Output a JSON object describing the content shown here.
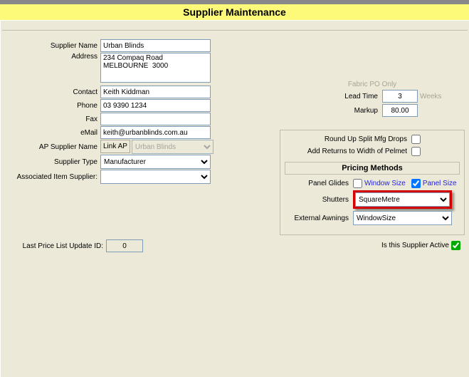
{
  "title": "Supplier Maintenance",
  "labels": {
    "supplier_name": "Supplier Name",
    "address": "Address",
    "contact": "Contact",
    "phone": "Phone",
    "fax": "Fax",
    "email": "eMail",
    "ap_supplier_name": "AP Supplier Name",
    "link_ap": "Link AP",
    "supplier_type": "Supplier Type",
    "associated_item_supplier": "Associated Item Supplier:",
    "last_price_id": "Last Price List Update ID:",
    "fabric_po_only": "Fabric PO Only",
    "lead_time": "Lead Time",
    "markup": "Markup",
    "weeks": "Weeks",
    "round_drops": "Round Up Split Mfg Drops",
    "add_returns": "Add Returns to Width of Pelmet",
    "pricing_methods": "Pricing Methods",
    "panel_glides": "Panel Glides",
    "window_size": "Window Size",
    "panel_size": "Panel Size",
    "shutters": "Shutters",
    "external_awnings": "External Awnings",
    "is_active": "Is this Supplier Active"
  },
  "values": {
    "supplier_name": "Urban Blinds",
    "address": "234 Compaq Road\nMELBOURNE  3000",
    "contact": "Keith Kiddman",
    "phone": "03 9390 1234",
    "fax": "",
    "email": "keith@urbanblinds.com.au",
    "ap_supplier_name": "Urban Blinds",
    "supplier_type": "Manufacturer",
    "associated_item_supplier": "",
    "lead_time": "3",
    "markup": "80.00",
    "shutters": "SquareMetre",
    "external_awnings": "WindowSize",
    "last_price_id": "0",
    "round_drops_checked": false,
    "add_returns_checked": false,
    "window_size_checked": false,
    "panel_size_checked": true,
    "is_active_checked": true
  },
  "options": {
    "supplier_type": [
      "Manufacturer"
    ],
    "shutters": [
      "SquareMetre"
    ],
    "external_awnings": [
      "WindowSize"
    ]
  }
}
